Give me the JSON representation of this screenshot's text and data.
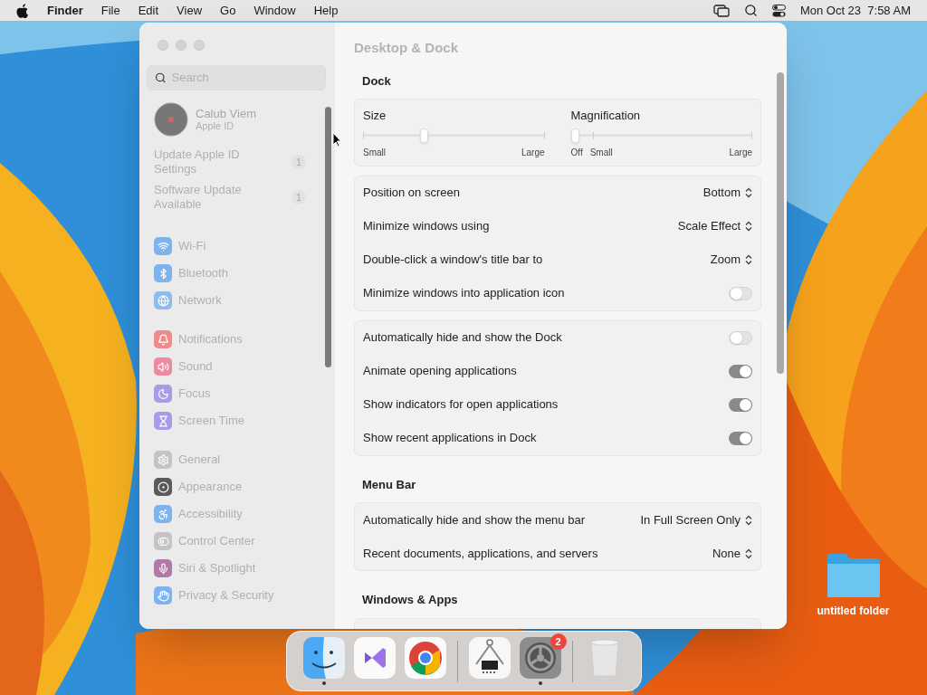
{
  "menu_bar": {
    "app": "Finder",
    "menus": [
      "File",
      "Edit",
      "View",
      "Go",
      "Window",
      "Help"
    ],
    "clock": "Mon Oct 23  7:58 AM"
  },
  "window": {
    "title": "Desktop & Dock",
    "sidebar": {
      "search": {
        "placeholder": "Search"
      },
      "account": {
        "name": "Calub Viem",
        "subtitle": "Apple ID"
      },
      "alerts": [
        {
          "label": "Update Apple ID Settings",
          "count": "1"
        },
        {
          "label": "Software Update Available",
          "count": "1"
        }
      ],
      "groups": [
        {
          "items": [
            {
              "label": "Wi-Fi",
              "color": "#7fb3ee"
            },
            {
              "label": "Bluetooth",
              "color": "#7fb3ee"
            },
            {
              "label": "Network",
              "color": "#8fbbee"
            }
          ]
        },
        {
          "items": [
            {
              "label": "Notifications",
              "color": "#f08a8a"
            },
            {
              "label": "Sound",
              "color": "#ee8aa0"
            },
            {
              "label": "Focus",
              "color": "#a99be8"
            },
            {
              "label": "Screen Time",
              "color": "#a99be8"
            }
          ]
        },
        {
          "items": [
            {
              "label": "General",
              "color": "#c4c4c4"
            },
            {
              "label": "Appearance",
              "color": "#5a5a5a"
            },
            {
              "label": "Accessibility",
              "color": "#7fb3ee"
            },
            {
              "label": "Control Center",
              "color": "#c4c4c4"
            },
            {
              "label": "Siri & Spotlight",
              "color": "#b07aa8"
            },
            {
              "label": "Privacy & Security",
              "color": "#7fb3ee"
            }
          ]
        }
      ]
    },
    "sections": [
      {
        "heading": "Dock",
        "cards": [
          {
            "kind": "sliders",
            "sliders": [
              {
                "label": "Size",
                "level": 0.33,
                "min_label": "Small",
                "max_label": "Large"
              },
              {
                "label": "Magnification",
                "level": 0,
                "off_label": "Off",
                "min_label": "Small",
                "max_label": "Large"
              }
            ]
          },
          {
            "kind": "rows",
            "rows": [
              {
                "kind": "select",
                "label": "Position on screen",
                "value": "Bottom"
              },
              {
                "kind": "select",
                "label": "Minimize windows using",
                "value": "Scale Effect"
              },
              {
                "kind": "select",
                "label": "Double-click a window's title bar to",
                "value": "Zoom"
              },
              {
                "kind": "toggle",
                "label": "Minimize windows into application icon",
                "on": false
              }
            ]
          },
          {
            "kind": "rows",
            "rows": [
              {
                "kind": "toggle",
                "label": "Automatically hide and show the Dock",
                "on": false
              },
              {
                "kind": "toggle",
                "label": "Animate opening applications",
                "on": true
              },
              {
                "kind": "toggle",
                "label": "Show indicators for open applications",
                "on": true
              },
              {
                "kind": "toggle",
                "label": "Show recent applications in Dock",
                "on": true
              }
            ]
          }
        ]
      },
      {
        "heading": "Menu Bar",
        "cards": [
          {
            "kind": "rows",
            "rows": [
              {
                "kind": "select",
                "label": "Automatically hide and show the menu bar",
                "value": "In Full Screen Only"
              },
              {
                "kind": "select",
                "label": "Recent documents, applications, and servers",
                "value": "None"
              }
            ]
          }
        ]
      },
      {
        "heading": "Windows & Apps",
        "cards": [
          {
            "kind": "rows"
          }
        ]
      }
    ]
  },
  "dock": {
    "items": [
      {
        "kind": "finder",
        "running": true
      },
      {
        "kind": "studio",
        "running": false
      },
      {
        "kind": "chrome",
        "running": false
      },
      {
        "kind": "separator"
      },
      {
        "kind": "chip",
        "running": false
      },
      {
        "kind": "settings",
        "running": true,
        "badge": "2"
      },
      {
        "kind": "separator"
      },
      {
        "kind": "trash",
        "running": false
      }
    ]
  },
  "desktop": {
    "folder": "untitled folder"
  }
}
